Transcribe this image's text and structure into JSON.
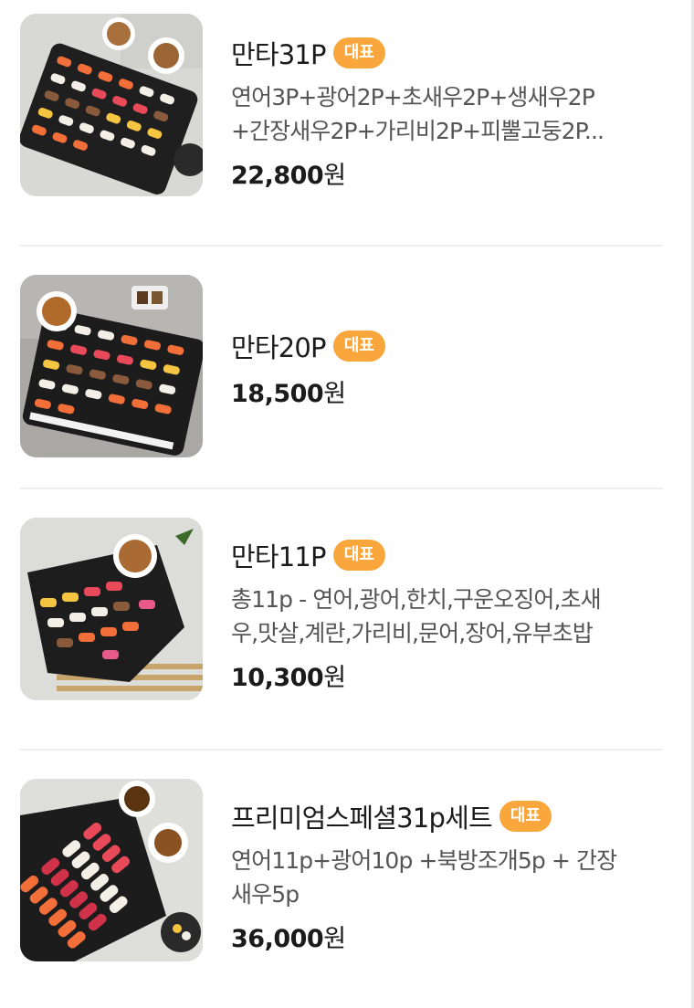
{
  "menu": {
    "badge_label": "대표",
    "items": [
      {
        "name": "만타31P",
        "desc_lines": [
          "연어3P+광어2P+초새우2P+생새우2P",
          "+간장새우2P+가리비2P+피뿔고둥2P..."
        ],
        "price": "22,800",
        "unit": "원"
      },
      {
        "name": "만타20P",
        "desc_lines": [],
        "price": "18,500",
        "unit": "원"
      },
      {
        "name": "만타11P",
        "desc_lines": [
          "총11p - 연어,광어,한치,구운오징어,초새",
          "우,맛살,계란,가리비,문어,장어,유부초밥"
        ],
        "price": "10,300",
        "unit": "원"
      },
      {
        "name": "프리미엄스페셜31p세트",
        "desc_lines": [
          "연어11p+광어10p +북방조개5p + 간장",
          "새우5p"
        ],
        "price": "36,000",
        "unit": "원"
      }
    ]
  }
}
